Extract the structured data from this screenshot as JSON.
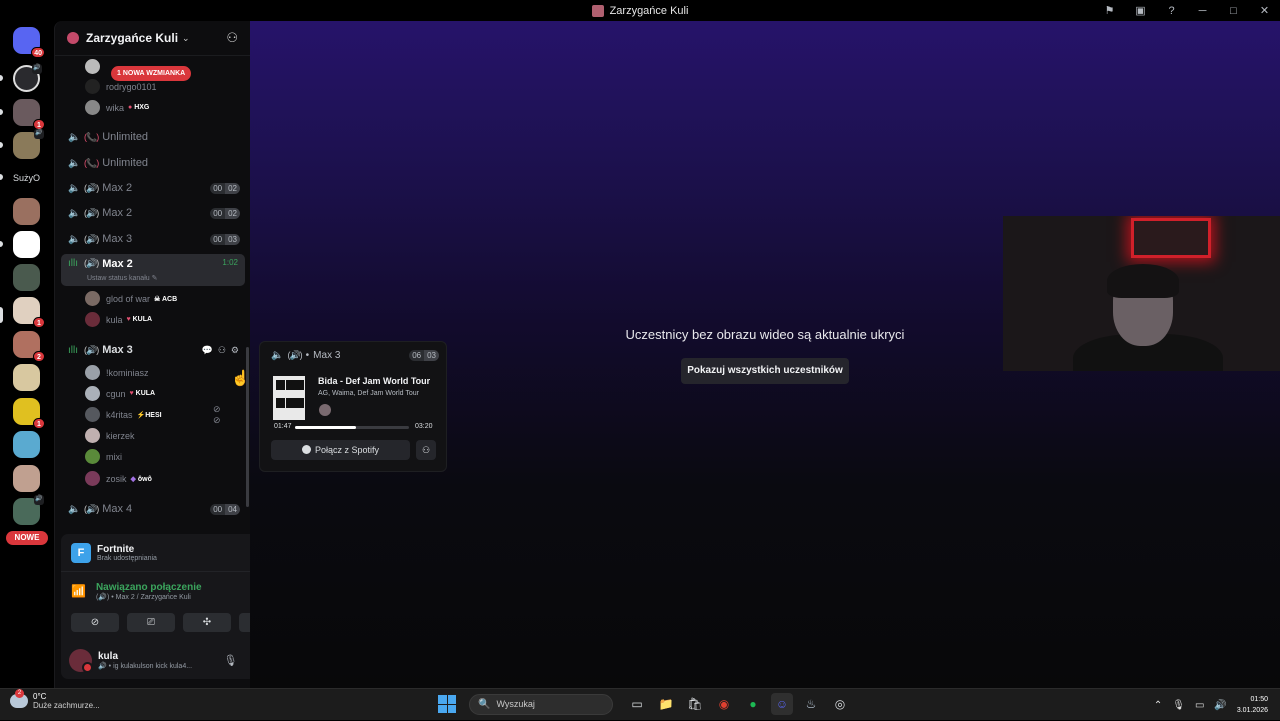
{
  "window": {
    "title": "Zarzygańce Kuli",
    "actions": [
      "⚑",
      "▣",
      "?",
      "─",
      "□",
      "✕"
    ]
  },
  "servers": {
    "home_badge": "40",
    "badges": [
      "1",
      "1",
      "2",
      "1"
    ],
    "text_server": "SużyO",
    "new_label": "NOWE"
  },
  "guild": {
    "name": "Zarzygańce Kuli",
    "mention_label": "1 NOWA WZMIANKA",
    "users_top": [
      {
        "name": "rodrygo0101",
        "tag": ""
      },
      {
        "name": "wika",
        "tag": "HXG"
      }
    ],
    "channels": [
      {
        "emoji": "(📞)",
        "name": "Unlimited"
      },
      {
        "emoji": "(📞)",
        "name": "Unlimited"
      },
      {
        "emoji": "(🔊)",
        "name": "Max 2",
        "count": "00",
        "limit": "02"
      },
      {
        "emoji": "(🔊)",
        "name": "Max 2",
        "count": "00",
        "limit": "02"
      },
      {
        "emoji": "(🔊)",
        "name": "Max 3",
        "count": "00",
        "limit": "03"
      }
    ],
    "active_channel": {
      "emoji": "(🔊)",
      "name": "Max 2",
      "timer": "1:02",
      "status_hint": "Ustaw status kanału"
    },
    "active_users": [
      {
        "name": "glod of war",
        "tag": "ACB"
      },
      {
        "name": "kula",
        "tag": "KULA"
      }
    ],
    "hover_channel": {
      "emoji": "(🔊)",
      "name": "Max 3"
    },
    "hover_users": [
      {
        "name": "!kominiasz",
        "tag": ""
      },
      {
        "name": "cgun",
        "tag": "KULA"
      },
      {
        "name": "k4ritas",
        "tag": "HESI"
      },
      {
        "name": "kierzek",
        "tag": ""
      },
      {
        "name": "mixi",
        "tag": ""
      },
      {
        "name": "zosik",
        "tag": "ôwô"
      }
    ],
    "last_channel": {
      "emoji": "(🔊)",
      "name": "Max 4",
      "count": "00",
      "limit": "04"
    }
  },
  "activity": {
    "game": "Fortnite",
    "status": "Brak udostępniania"
  },
  "voice": {
    "title": "Nawiązano połączenie",
    "location": "Max 2 / Zarzygańce Kuli"
  },
  "user": {
    "name": "kula",
    "status": "ig kulakulson kick kula4..."
  },
  "stage": {
    "hidden_message": "Uczestnicy bez obrazu wideo są aktualnie ukryci",
    "show_button": "Pokazuj wszystkich uczestników"
  },
  "popup": {
    "channel": "Max 3",
    "count": "06",
    "limit": "03",
    "song": "Bida - Def Jam World Tour",
    "artist": "AG, Waima, Def Jam World Tour",
    "elapsed": "01:47",
    "duration": "03:20",
    "progress": 0.535,
    "spotify_button": "Połącz z Spotify"
  },
  "taskbar": {
    "temp": "0°C",
    "weather": "Duże zachmurze...",
    "weather_badge": "2",
    "search_placeholder": "Wyszukaj",
    "time": "01:50",
    "date": "3.01.2026"
  }
}
